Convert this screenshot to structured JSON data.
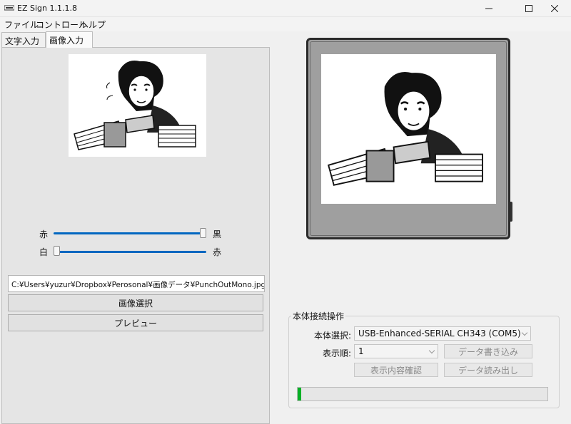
{
  "window": {
    "title": "EZ Sign 1.1.1.8",
    "minimize_glyph": "—",
    "maximize_glyph": "☐",
    "close_glyph": "✕"
  },
  "menu": [
    "ファイル",
    "コントロール",
    "ヘルプ"
  ],
  "tabs": [
    {
      "label": "文字入力",
      "active": false
    },
    {
      "label": "画像入力",
      "active": true
    }
  ],
  "image_input": {
    "slider1": {
      "left_label": "赤",
      "right_label": "黒",
      "level": 1.0
    },
    "slider2": {
      "left_label": "白",
      "right_label": "赤",
      "level": 0.0
    },
    "file_path": "C:¥Users¥yuzur¥Dropbox¥Perosonal¥画像データ¥PunchOutMono.jpg",
    "select_image_button": "画像選択",
    "preview_button": "プレビュー"
  },
  "device_panel": {
    "group_title": "本体接続操作",
    "device_select_label": "本体選択:",
    "device_select_value": "USB-Enhanced-SERIAL CH343 (COM5)",
    "display_order_label": "表示順:",
    "display_order_value": "1",
    "write_data_button": "データ書き込み",
    "read_data_button": "データ読み出し",
    "confirm_display_button": "表示内容確認",
    "progress": 0.015
  },
  "colors": {
    "accent": "#0067c0",
    "progress": "#06b025",
    "device_frame": "#2b2b2b",
    "device_body": "#9f9f9f"
  },
  "icons": [
    "app-icon",
    "minimize-icon",
    "maximize-icon",
    "close-icon",
    "chevron-down-icon"
  ]
}
